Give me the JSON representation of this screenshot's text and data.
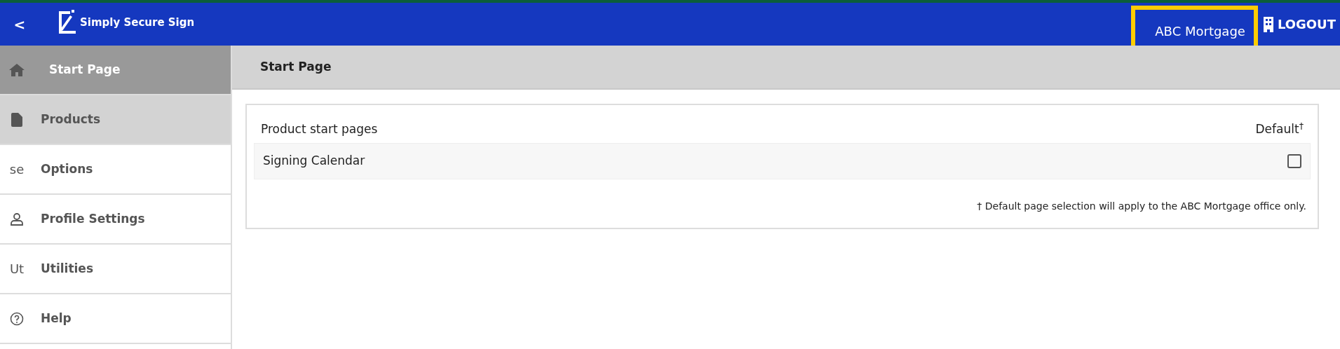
{
  "header": {
    "back": "<",
    "logo_text": "Simply Secure Sign",
    "organization": {
      "label": "ABC Mortgage",
      "highlighted": true
    },
    "logout": "LOGOUT"
  },
  "sidebar": {
    "items": [
      {
        "kind": "home",
        "label": "Start Page",
        "selected": true,
        "hovered": false
      },
      {
        "kind": "file",
        "label": "Products",
        "selected": false,
        "hovered": true
      },
      {
        "kind": "text",
        "icon_text": "se",
        "label": "Options",
        "selected": false,
        "hovered": false
      },
      {
        "kind": "person",
        "label": "Profile Settings",
        "selected": false,
        "hovered": false
      },
      {
        "kind": "text",
        "icon_text": "Ut",
        "label": "Utilities",
        "selected": false,
        "hovered": false
      },
      {
        "kind": "help",
        "label": "Help",
        "selected": false,
        "hovered": false
      }
    ]
  },
  "page_title": "Start Page",
  "table": {
    "columns": [
      "Product start pages",
      "Default$^{†}$"
    ],
    "rows": [
      {
        "name": "Signing Calendar",
        "checked": false
      }
    ],
    "footnote": "† Default page selection will apply to the ABC Mortgage office only."
  }
}
